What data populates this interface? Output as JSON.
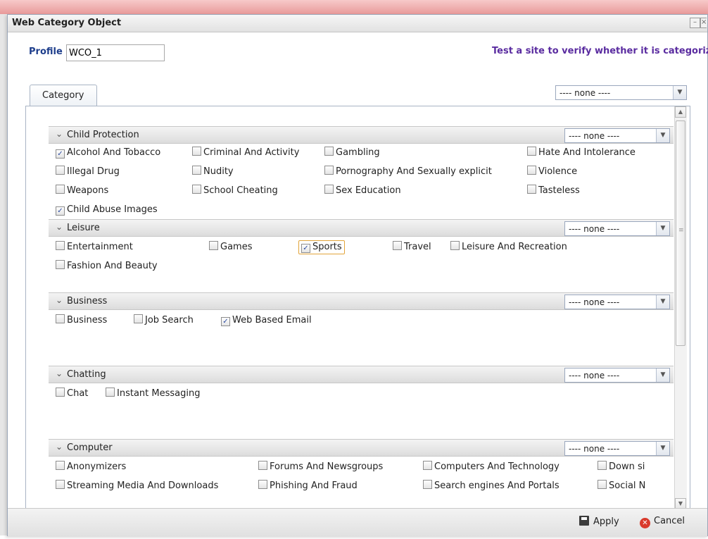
{
  "window": {
    "title": "Web Category Object"
  },
  "profile": {
    "label": "Profile :",
    "value": "WCO_1"
  },
  "test_link": "Test a site to verify whether it is categoriz",
  "tab": {
    "label": "Category"
  },
  "top_select": {
    "value": "---- none ----"
  },
  "groups": [
    {
      "title": "Child Protection",
      "select": "---- none ----",
      "items": [
        {
          "label": "Alcohol And Tobacco",
          "checked": true
        },
        {
          "label": "Criminal And Activity",
          "checked": false
        },
        {
          "label": "Gambling",
          "checked": false
        },
        {
          "label": "Hate And Intolerance",
          "checked": false
        },
        {
          "label": "Illegal Drug",
          "checked": false
        },
        {
          "label": "Nudity",
          "checked": false
        },
        {
          "label": "Pornography And Sexually explicit",
          "checked": false
        },
        {
          "label": "Violence",
          "checked": false
        },
        {
          "label": "Weapons",
          "checked": false
        },
        {
          "label": "School Cheating",
          "checked": false
        },
        {
          "label": "Sex Education",
          "checked": false
        },
        {
          "label": "Tasteless",
          "checked": false
        },
        {
          "label": "Child Abuse Images",
          "checked": true
        }
      ]
    },
    {
      "title": "Leisure",
      "select": "---- none ----",
      "items": [
        {
          "label": "Entertainment",
          "checked": false
        },
        {
          "label": "Games",
          "checked": false
        },
        {
          "label": "Sports",
          "checked": true
        },
        {
          "label": "Travel",
          "checked": false
        },
        {
          "label": "Leisure And Recreation",
          "checked": false
        },
        {
          "label": "Fashion And Beauty",
          "checked": false
        }
      ]
    },
    {
      "title": "Business",
      "select": "---- none ----",
      "items": [
        {
          "label": "Business",
          "checked": false
        },
        {
          "label": "Job Search",
          "checked": false
        },
        {
          "label": "Web Based Email",
          "checked": true
        }
      ]
    },
    {
      "title": "Chatting",
      "select": "---- none ----",
      "items": [
        {
          "label": "Chat",
          "checked": false
        },
        {
          "label": "Instant Messaging",
          "checked": false
        }
      ]
    },
    {
      "title": "Computer",
      "select": "---- none ----",
      "items": [
        {
          "label": "Anonymizers",
          "checked": false
        },
        {
          "label": "Forums And Newsgroups",
          "checked": false
        },
        {
          "label": "Computers And Technology",
          "checked": false
        },
        {
          "label": "Down si",
          "checked": false
        },
        {
          "label": "Streaming Media And Downloads",
          "checked": false
        },
        {
          "label": "Phishing And Fraud",
          "checked": false
        },
        {
          "label": "Search engines And Portals",
          "checked": false
        },
        {
          "label": "Social N",
          "checked": false
        }
      ]
    }
  ],
  "footer": {
    "apply": "Apply",
    "cancel": "Cancel"
  }
}
